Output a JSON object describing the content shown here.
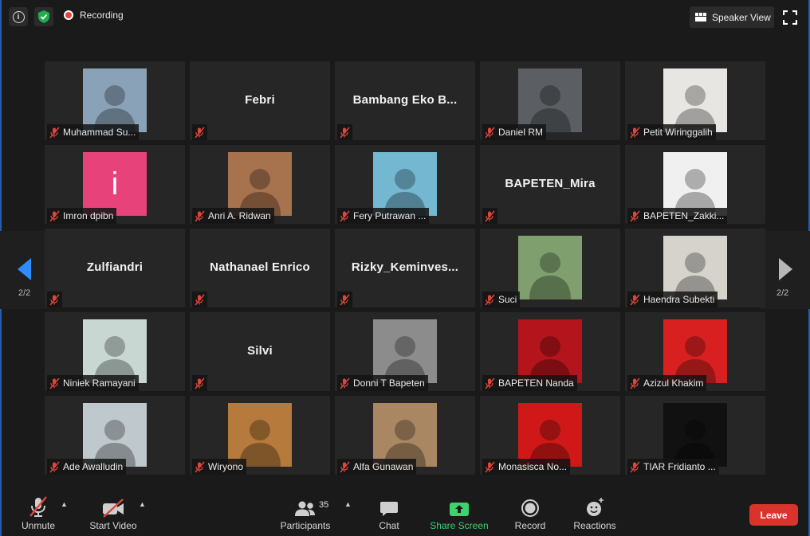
{
  "topbar": {
    "recording_label": "Recording",
    "speaker_view_label": "Speaker View",
    "colors": {
      "recording_dot": "#e0453a",
      "shield": "#1fae4c"
    }
  },
  "paging": {
    "left_label": "2/2",
    "right_label": "2/2",
    "left_arrow_color": "#2d8cff"
  },
  "participants": [
    {
      "name": "Muhammad Su...",
      "label": "Muhammad Su...",
      "video": true,
      "bg": "#8aa2b7"
    },
    {
      "name": "Febri",
      "label": "",
      "video": false
    },
    {
      "name": "Bambang Eko B...",
      "label": "",
      "video": false
    },
    {
      "name": "Daniel RM",
      "label": "Daniel RM",
      "video": true,
      "bg": "#5b5f63"
    },
    {
      "name": "Petit Wiringgalih",
      "label": "Petit Wiringgalih",
      "video": true,
      "bg": "#e8e6e2"
    },
    {
      "name": "Imron dpibn",
      "label": "Imron dpibn",
      "video": true,
      "bg": "#e8427a",
      "initial": "i"
    },
    {
      "name": "Anri A. Ridwan",
      "label": "Anri A. Ridwan",
      "video": true,
      "bg": "#a7724e"
    },
    {
      "name": "Fery Putrawan ...",
      "label": "Fery Putrawan ...",
      "video": true,
      "bg": "#73b7d1"
    },
    {
      "name": "BAPETEN_Mira",
      "label": "",
      "video": false
    },
    {
      "name": "BAPETEN_Zakki...",
      "label": "BAPETEN_Zakki...",
      "video": true,
      "bg": "#f0f0f0"
    },
    {
      "name": "Zulfiandri",
      "label": "",
      "video": false
    },
    {
      "name": "Nathanael Enrico",
      "label": "",
      "video": false
    },
    {
      "name": "Rizky_Keminves...",
      "label": "",
      "video": false
    },
    {
      "name": "Suci",
      "label": "Suci",
      "video": true,
      "bg": "#7fa06e"
    },
    {
      "name": "Haendra Subekti",
      "label": "Haendra Subekti",
      "video": true,
      "bg": "#d6d3cd"
    },
    {
      "name": "Niniek Ramayani",
      "label": "Niniek Ramayani",
      "video": true,
      "bg": "#c9d7d2"
    },
    {
      "name": "Silvi",
      "label": "",
      "video": false
    },
    {
      "name": "Donni T Bapeten",
      "label": "Donni T Bapeten",
      "video": true,
      "bg": "#8c8c8c"
    },
    {
      "name": "BAPETEN Nanda",
      "label": "BAPETEN Nanda",
      "video": true,
      "bg": "#b4141b"
    },
    {
      "name": "Azizul Khakim",
      "label": "Azizul Khakim",
      "video": true,
      "bg": "#d92020"
    },
    {
      "name": "Ade Awalludin",
      "label": "Ade Awalludin",
      "video": true,
      "bg": "#bfc8cc"
    },
    {
      "name": "Wiryono",
      "label": "Wiryono",
      "video": true,
      "bg": "#b57a3c"
    },
    {
      "name": "Alfa Gunawan",
      "label": "Alfa Gunawan",
      "video": true,
      "bg": "#a98763"
    },
    {
      "name": "Monasisca No...",
      "label": "Monasisca No...",
      "video": true,
      "bg": "#d01818"
    },
    {
      "name": "TIAR Fridianto ...",
      "label": "TIAR Fridianto ...",
      "video": true,
      "bg": "#111111"
    }
  ],
  "toolbar": {
    "unmute_label": "Unmute",
    "start_video_label": "Start Video",
    "participants_label": "Participants",
    "participants_count": "35",
    "chat_label": "Chat",
    "share_screen_label": "Share Screen",
    "record_label": "Record",
    "reactions_label": "Reactions",
    "leave_label": "Leave",
    "colors": {
      "share": "#3dd36f",
      "leave": "#d9342b",
      "muted_slash": "#e0453a"
    }
  }
}
